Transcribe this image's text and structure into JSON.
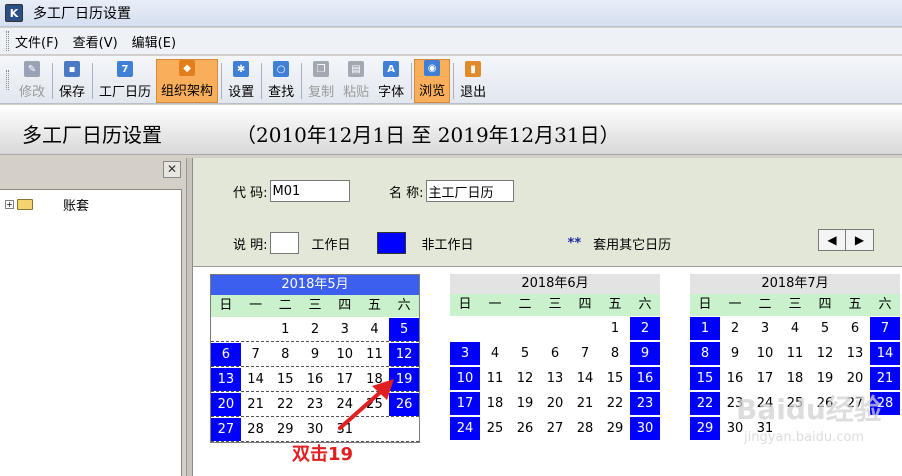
{
  "window": {
    "title": "多工厂日历设置",
    "icon": "app-logo-icon"
  },
  "menu": [
    {
      "label": "文件(F)"
    },
    {
      "label": "查看(V)"
    },
    {
      "label": "编辑(E)"
    }
  ],
  "toolbar": [
    {
      "label": "修改",
      "icon": "edit-icon",
      "state": "disabled"
    },
    {
      "label": "保存",
      "icon": "save-icon",
      "state": "normal"
    },
    {
      "label": "工厂日历",
      "icon": "calendar-icon",
      "state": "normal"
    },
    {
      "label": "组织架构",
      "icon": "org-chart-icon",
      "state": "active"
    },
    {
      "label": "设置",
      "icon": "gear-icon",
      "state": "normal"
    },
    {
      "label": "查找",
      "icon": "search-icon",
      "state": "normal"
    },
    {
      "label": "复制",
      "icon": "copy-icon",
      "state": "disabled"
    },
    {
      "label": "粘贴",
      "icon": "paste-icon",
      "state": "disabled"
    },
    {
      "label": "字体",
      "icon": "font-icon",
      "state": "normal"
    },
    {
      "label": "浏览",
      "icon": "browse-icon",
      "state": "active"
    },
    {
      "label": "退出",
      "icon": "exit-icon",
      "state": "normal"
    }
  ],
  "banner": {
    "title": "多工厂日历设置",
    "range": "（2010年12月1日  至  2019年12月31日）"
  },
  "tree": {
    "close": "✕",
    "root_label": "账套"
  },
  "form": {
    "code_label": "代    码:",
    "code_value": "M01",
    "name_label": "名  称:",
    "name_value": "主工厂日历",
    "desc_label": "说    明:",
    "workday_label": "工作日",
    "nonworkday_label": "非工作日",
    "other_mark": "**",
    "other_label": "套用其它日历",
    "prev": "◀",
    "next": "▶"
  },
  "colors": {
    "nonwork": "#0000ff",
    "selected_header": "#3c5ff0",
    "weekday_header": "#c9f2cc"
  },
  "weekdays": [
    "日",
    "一",
    "二",
    "三",
    "四",
    "五",
    "六"
  ],
  "months": [
    {
      "title": "2018年5月",
      "selected": true,
      "weeks": [
        [
          "",
          "",
          "1",
          "2",
          "3",
          "4",
          "5"
        ],
        [
          "6",
          "7",
          "8",
          "9",
          "10",
          "11",
          "12"
        ],
        [
          "13",
          "14",
          "15",
          "16",
          "17",
          "18",
          "19"
        ],
        [
          "20",
          "21",
          "22",
          "23",
          "24",
          "25",
          "26"
        ],
        [
          "27",
          "28",
          "29",
          "30",
          "31",
          "",
          ""
        ]
      ]
    },
    {
      "title": "2018年6月",
      "selected": false,
      "weeks": [
        [
          "",
          "",
          "",
          "",
          "",
          "1",
          "2"
        ],
        [
          "3",
          "4",
          "5",
          "6",
          "7",
          "8",
          "9"
        ],
        [
          "10",
          "11",
          "12",
          "13",
          "14",
          "15",
          "16"
        ],
        [
          "17",
          "18",
          "19",
          "20",
          "21",
          "22",
          "23"
        ],
        [
          "24",
          "25",
          "26",
          "27",
          "28",
          "29",
          "30"
        ]
      ]
    },
    {
      "title": "2018年7月",
      "selected": false,
      "weeks": [
        [
          "1",
          "2",
          "3",
          "4",
          "5",
          "6",
          "7"
        ],
        [
          "8",
          "9",
          "10",
          "11",
          "12",
          "13",
          "14"
        ],
        [
          "15",
          "16",
          "17",
          "18",
          "19",
          "20",
          "21"
        ],
        [
          "22",
          "23",
          "24",
          "25",
          "26",
          "27",
          "28"
        ],
        [
          "29",
          "30",
          "31",
          "",
          "",
          "",
          ""
        ]
      ]
    }
  ],
  "annotation": {
    "text": "双击19"
  },
  "watermark": {
    "main": "Baidu经验",
    "sub": "jingyan.baidu.com"
  }
}
